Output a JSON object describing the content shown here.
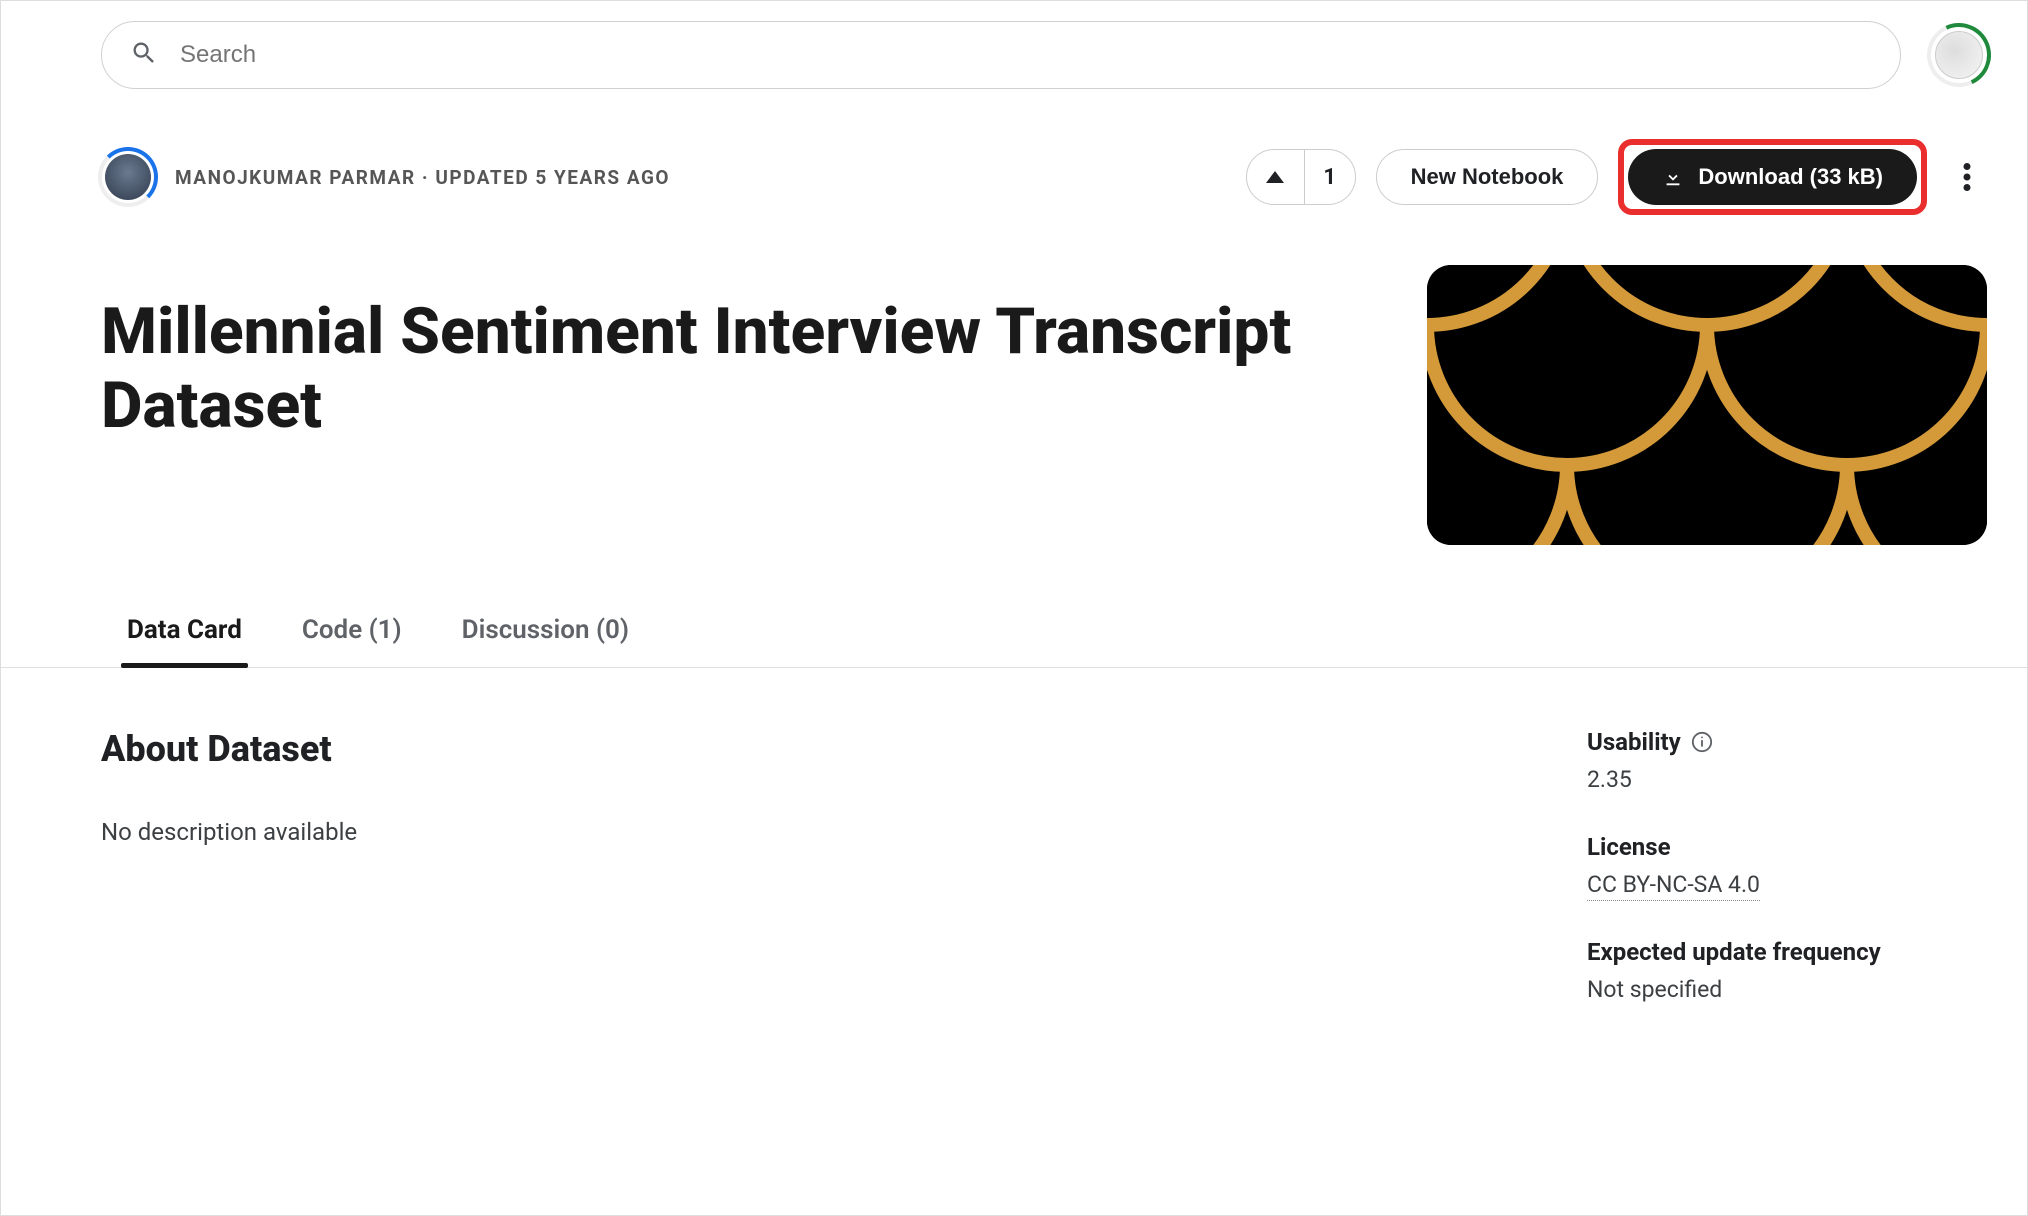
{
  "search": {
    "placeholder": "Search"
  },
  "owner": {
    "name": "MANOJKUMAR PARMAR",
    "updated": "UPDATED 5 YEARS AGO"
  },
  "vote": {
    "count": "1"
  },
  "actions": {
    "new_notebook": "New Notebook",
    "download": "Download (33 kB)"
  },
  "title": "Millennial Sentiment Interview Transcript Dataset",
  "tabs": [
    {
      "label": "Data Card",
      "active": true
    },
    {
      "label": "Code (1)",
      "active": false
    },
    {
      "label": "Discussion (0)",
      "active": false
    }
  ],
  "about": {
    "heading": "About Dataset",
    "description": "No description available"
  },
  "sidebar": {
    "usability": {
      "label": "Usability",
      "value": "2.35"
    },
    "license": {
      "label": "License",
      "value": "CC BY-NC-SA 4.0"
    },
    "update_freq": {
      "label": "Expected update frequency",
      "value": "Not specified"
    }
  }
}
